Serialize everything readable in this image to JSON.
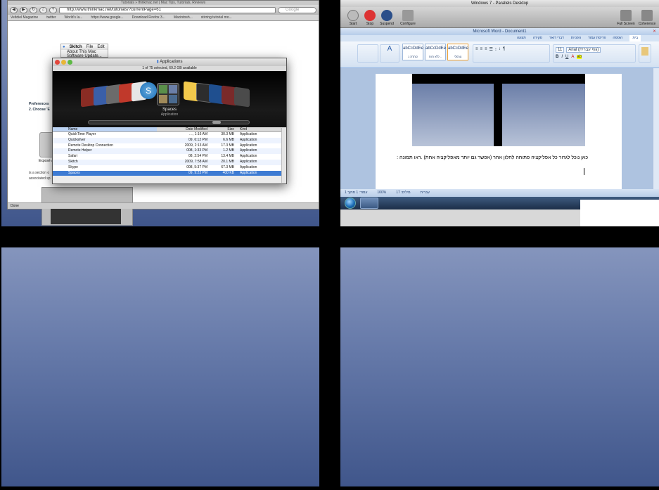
{
  "safari": {
    "title": "Tutorials » thinkmac.net | Mac Tips, Tutorials, Reviews",
    "url": "http://www.thinkmac.net/tutorials/?currentPage=61",
    "search_placeholder": "Google",
    "bookmarks": [
      "Veltdiel Magazine",
      "twitter",
      "World's la...",
      "https://www.google...",
      "Download Firefox 3...",
      "Macintosh...",
      "stirring tutorial mo..."
    ],
    "content": {
      "pref_heading": "Preferences",
      "pref_step": "2. Choose 'E",
      "expose_label": "Exposé & Spaces",
      "section_text_1": "is a section o",
      "section_text_2": "associated sp"
    },
    "status": "Done"
  },
  "skitch_menu": {
    "items": [
      "Skitch",
      "File",
      "Edit"
    ],
    "entries": [
      "About This Mac",
      "Software Update..."
    ]
  },
  "finder": {
    "title": "Applications",
    "info": "1 of 75 selected, 69.2 GB available",
    "selected_app": "Spaces",
    "selected_kind": "Application",
    "columns": {
      "name": "Name",
      "date": "Date Modified",
      "size": "Size",
      "kind": "Kind"
    },
    "rows": [
      {
        "name": "QuickTime Player",
        "date": "…, 1:16 AM",
        "size": "30.3 MB",
        "kind": "Application"
      },
      {
        "name": "Quicksilver",
        "date": "09, 6:12 PM",
        "size": "6.6 MB",
        "kind": "Application"
      },
      {
        "name": "Remote Desktop Connection",
        "date": "2009, 2:13 AM",
        "size": "17.3 MB",
        "kind": "Application"
      },
      {
        "name": "Remote Helper",
        "date": "008, 1:33 PM",
        "size": "1.2 MB",
        "kind": "Application"
      },
      {
        "name": "Safari",
        "date": "08, 2:54 PM",
        "size": "13.4 MB",
        "kind": "Application"
      },
      {
        "name": "Skitch",
        "date": "2009, 7:58 AM",
        "size": "20.1 MB",
        "kind": "Application"
      },
      {
        "name": "Skype",
        "date": "008, 5:37 PM",
        "size": "67.3 MB",
        "kind": "Application"
      },
      {
        "name": "Spaces",
        "date": "09, 9:23 PM",
        "size": "400 KB",
        "kind": "Application"
      }
    ]
  },
  "parallels": {
    "title": "Windows 7 - Parallels Desktop",
    "buttons": [
      "Start",
      "Stop",
      "Suspend",
      "Configure"
    ],
    "right_buttons": [
      "Full Screen",
      "Coherence"
    ]
  },
  "word": {
    "title": "Microsoft Word - Document1",
    "tabs": [
      "בית",
      "הוספה",
      "פריסת עמוד",
      "הפניות",
      "דברי דואר",
      "סקירה",
      "תצוגה"
    ],
    "styles": [
      "abCcDdEe",
      "abCcDdEe",
      "abCcDdEe"
    ],
    "style_names": [
      "נורמלי",
      "ללא רווח...",
      "כותרת 1"
    ],
    "font": "Arial (גוף עברית)",
    "font_size": "11",
    "doc_text": "כאן נוכל לגרור כל אפליקציה פתוחה לחלון אחר (אפשר גם יותר מאפליקציה אחת) .ראו תמונה :",
    "status": [
      "עמוד: 1 מתוך 1",
      "מילים: 17",
      "עברית"
    ],
    "zoom": "100%"
  },
  "colors": {
    "desktop_blue": "#5a6e9e",
    "finder_selection": "#3d7bd3",
    "word_ribbon": "#d3e1f2"
  }
}
